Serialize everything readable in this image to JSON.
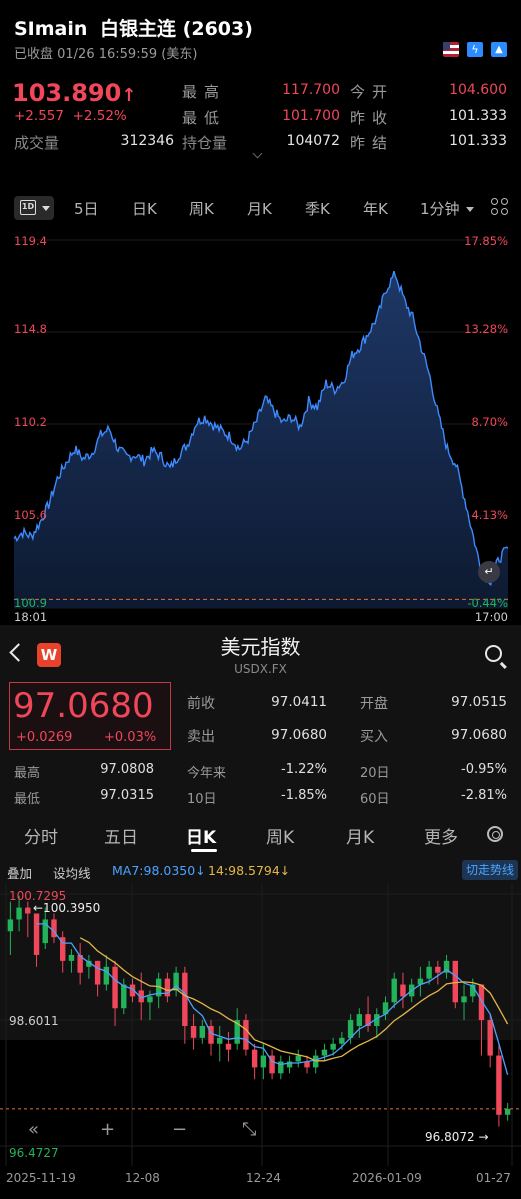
{
  "header": {
    "symbol": "SImain",
    "name": "白银主连 (2603)",
    "status": "已收盘 01/26 16:59:59 (美东)",
    "icons": [
      "us-flag-icon",
      "lightning-icon",
      "exchange-icon"
    ]
  },
  "quote": {
    "price": "103.890",
    "arrow": "↑",
    "change": "+2.557",
    "change_pct": "+2.52%",
    "high_label": "最高",
    "high": "117.700",
    "low_label": "最低",
    "low": "101.700",
    "volume_label": "成交量",
    "volume": "312346",
    "oi_label": "持仓量",
    "oi": "104072",
    "open_label": "今开",
    "open": "104.600",
    "prev_label": "昨收",
    "prev": "101.333",
    "settle_label": "昨结",
    "settle": "101.333"
  },
  "period_tabs": {
    "selected": "1D",
    "items": [
      "5日",
      "日K",
      "周K",
      "月K",
      "季K",
      "年K",
      "1分钟"
    ]
  },
  "intraday": {
    "y_left": [
      "119.4",
      "114.8",
      "110.2",
      "105.6",
      "100.9"
    ],
    "y_right": [
      "17.85%",
      "13.28%",
      "8.70%",
      "4.13%",
      "-0.44%"
    ],
    "x_start": "18:01",
    "x_end": "17:00",
    "rewind_icon": "↵"
  },
  "usdx": {
    "title": "美元指数",
    "code": "USDX.FX",
    "logo": "W",
    "price": "97.0680",
    "change": "+0.0269",
    "change_pct": "+0.03%",
    "stats": [
      {
        "label": "前收",
        "value": "97.0411"
      },
      {
        "label": "开盘",
        "value": "97.0515"
      },
      {
        "label": "卖出",
        "value": "97.0680"
      },
      {
        "label": "买入",
        "value": "97.0680"
      },
      {
        "label": "最高",
        "value": "97.0808"
      },
      {
        "label": "今年来",
        "value": "-1.22%"
      },
      {
        "label": "20日",
        "value": "-0.95%"
      },
      {
        "label": "最低",
        "value": "97.0315"
      },
      {
        "label": "10日",
        "value": "-1.85%"
      },
      {
        "label": "60日",
        "value": "-2.81%"
      }
    ],
    "tabs": [
      "分时",
      "五日",
      "日K",
      "周K",
      "月K",
      "更多"
    ],
    "selected_tab": "日K",
    "overlay_label": "叠加",
    "ma_line_label": "设均线",
    "ma7": "MA7:98.0350↓",
    "ma14": "14:98.5794↓",
    "trend_button": "切走势线",
    "kline": {
      "y_top": "100.7295",
      "y_mid": "98.6011",
      "y_bot": "96.4727",
      "high_mark": "←100.3950",
      "low_mark": "96.8072 →",
      "x_labels": [
        "2025-11-19",
        "12-08",
        "12-24",
        "2026-01-09",
        "01-27"
      ],
      "controls": [
        "«",
        "+",
        "−",
        "⤡"
      ]
    }
  },
  "colors": {
    "up": "#f0475a",
    "down": "#22b25a",
    "line": "#3d8bff",
    "ma7": "#4aa3ff",
    "ma14": "#e3b64a"
  },
  "chart_data": [
    {
      "type": "area",
      "title": "",
      "y_range": [
        100.9,
        119.4
      ],
      "baseline_prev_close": 101.333,
      "x_range": [
        "18:01",
        "17:00"
      ],
      "series": [
        {
          "values": [
            104.4,
            104.7,
            104.5,
            105.2,
            106.1,
            107.4,
            108.2,
            108.9,
            108.4,
            108.7,
            109.6,
            109.9,
            108.9,
            108.5,
            108.6,
            108.3,
            108.8,
            108.5,
            107.9,
            108.6,
            109.1,
            110.2,
            110.5,
            110.1,
            109.8,
            109.5,
            108.9,
            109.4,
            110.3,
            111.4,
            110.8,
            110.2,
            110.5,
            110.0,
            111.3,
            111.0,
            112.2,
            111.9,
            112.3,
            113.6,
            114.1,
            114.8,
            115.6,
            117.0,
            117.7,
            116.4,
            115.5,
            114.0,
            112.5,
            110.5,
            108.9,
            108.1,
            106.4,
            104.5,
            102.6,
            102.3,
            103.4,
            103.9
          ]
        }
      ],
      "ylabel_right": "%"
    },
    {
      "type": "candlestick",
      "title": "",
      "y_range": [
        96.4727,
        100.7295
      ],
      "x_labels": [
        "2025-11-19",
        "12-08",
        "12-24",
        "2026-01-09",
        "01-27"
      ],
      "annotations": {
        "high": 100.395,
        "low": 96.8072
      },
      "candles": [
        [
          100.1,
          100.6,
          99.7,
          100.3
        ],
        [
          100.3,
          100.7,
          100.1,
          100.5
        ],
        [
          100.5,
          100.6,
          100.0,
          100.4
        ],
        [
          100.4,
          100.4,
          99.5,
          99.7
        ],
        [
          99.9,
          100.5,
          99.8,
          100.3
        ],
        [
          100.3,
          100.4,
          99.9,
          100.0
        ],
        [
          100.0,
          100.1,
          99.4,
          99.6
        ],
        [
          99.6,
          99.8,
          99.4,
          99.7
        ],
        [
          99.7,
          99.9,
          99.2,
          99.4
        ],
        [
          99.5,
          99.7,
          99.3,
          99.6
        ],
        [
          99.6,
          99.6,
          99.0,
          99.2
        ],
        [
          99.2,
          99.7,
          99.1,
          99.5
        ],
        [
          99.5,
          99.6,
          98.5,
          98.8
        ],
        [
          98.8,
          99.3,
          98.7,
          99.2
        ],
        [
          99.2,
          99.3,
          98.9,
          99.0
        ],
        [
          99.1,
          99.4,
          98.6,
          98.9
        ],
        [
          98.9,
          99.1,
          98.6,
          99.0
        ],
        [
          99.0,
          99.4,
          98.8,
          99.3
        ],
        [
          99.3,
          99.4,
          98.9,
          99.0
        ],
        [
          99.1,
          99.5,
          99.0,
          99.4
        ],
        [
          99.4,
          99.5,
          98.2,
          98.5
        ],
        [
          98.5,
          98.7,
          98.1,
          98.3
        ],
        [
          98.3,
          98.6,
          98.2,
          98.5
        ],
        [
          98.5,
          98.6,
          98.0,
          98.2
        ],
        [
          98.2,
          98.5,
          97.9,
          98.3
        ],
        [
          98.2,
          98.4,
          97.9,
          98.1
        ],
        [
          98.2,
          98.8,
          98.1,
          98.6
        ],
        [
          98.6,
          98.7,
          98.0,
          98.1
        ],
        [
          98.1,
          98.2,
          97.6,
          97.8
        ],
        [
          97.8,
          98.2,
          97.6,
          98.0
        ],
        [
          98.0,
          98.1,
          97.6,
          97.7
        ],
        [
          97.7,
          98.0,
          97.6,
          97.9
        ],
        [
          97.8,
          98.0,
          97.7,
          97.9
        ],
        [
          97.9,
          98.1,
          97.8,
          98.0
        ],
        [
          97.9,
          98.0,
          97.7,
          97.8
        ],
        [
          97.8,
          98.1,
          97.7,
          98.0
        ],
        [
          98.0,
          98.2,
          97.9,
          98.1
        ],
        [
          98.1,
          98.3,
          98.0,
          98.2
        ],
        [
          98.2,
          98.4,
          98.1,
          98.3
        ],
        [
          98.3,
          98.7,
          98.2,
          98.6
        ],
        [
          98.5,
          98.8,
          98.3,
          98.7
        ],
        [
          98.7,
          99.0,
          98.4,
          98.5
        ],
        [
          98.5,
          98.8,
          98.3,
          98.7
        ],
        [
          98.7,
          99.0,
          98.6,
          98.9
        ],
        [
          98.9,
          99.4,
          98.8,
          99.3
        ],
        [
          99.2,
          99.4,
          98.8,
          99.0
        ],
        [
          99.0,
          99.3,
          98.9,
          99.2
        ],
        [
          99.2,
          99.5,
          99.0,
          99.3
        ],
        [
          99.3,
          99.6,
          99.2,
          99.5
        ],
        [
          99.5,
          99.6,
          99.2,
          99.4
        ],
        [
          99.4,
          99.7,
          99.3,
          99.6
        ],
        [
          99.6,
          99.6,
          98.8,
          98.9
        ],
        [
          98.9,
          99.2,
          98.6,
          99.0
        ],
        [
          99.0,
          99.3,
          98.9,
          99.2
        ],
        [
          99.2,
          99.2,
          98.0,
          98.6
        ],
        [
          98.6,
          98.7,
          97.8,
          98.0
        ],
        [
          98.0,
          98.2,
          96.8,
          97.0
        ],
        [
          97.0,
          97.2,
          96.9,
          97.1
        ]
      ]
    }
  ]
}
